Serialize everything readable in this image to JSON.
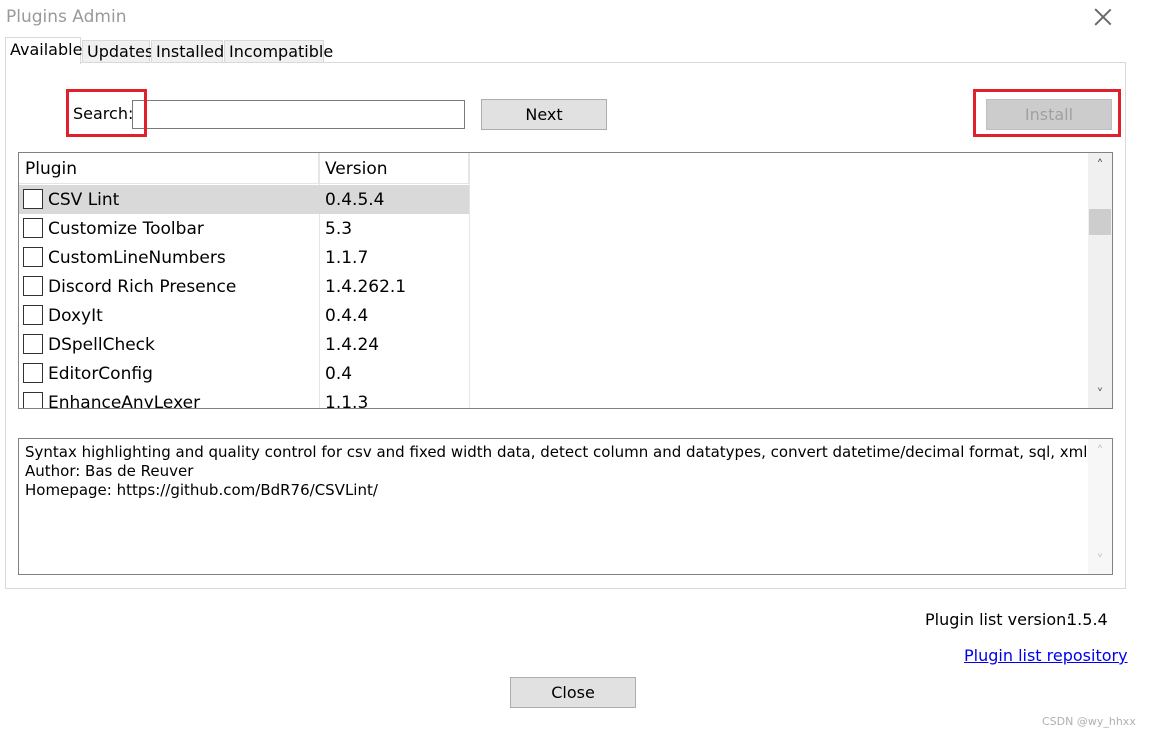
{
  "window": {
    "title": "Plugins Admin"
  },
  "tabs": [
    {
      "label": "Available",
      "active": true
    },
    {
      "label": "Updates",
      "active": false
    },
    {
      "label": "Installed",
      "active": false
    },
    {
      "label": "Incompatible",
      "active": false
    }
  ],
  "search": {
    "label": "Search:",
    "value": "",
    "placeholder": ""
  },
  "buttons": {
    "next": "Next",
    "install": "Install",
    "close": "Close"
  },
  "list": {
    "columns": [
      "Plugin",
      "Version"
    ],
    "rows": [
      {
        "name": "CSV Lint",
        "version": "0.4.5.4",
        "checked": false,
        "selected": true
      },
      {
        "name": "Customize Toolbar",
        "version": "5.3",
        "checked": false,
        "selected": false
      },
      {
        "name": "CustomLineNumbers",
        "version": "1.1.7",
        "checked": false,
        "selected": false
      },
      {
        "name": "Discord Rich Presence",
        "version": "1.4.262.1",
        "checked": false,
        "selected": false
      },
      {
        "name": "DoxyIt",
        "version": "0.4.4",
        "checked": false,
        "selected": false
      },
      {
        "name": "DSpellCheck",
        "version": "1.4.24",
        "checked": false,
        "selected": false
      },
      {
        "name": "EditorConfig",
        "version": "0.4",
        "checked": false,
        "selected": false
      },
      {
        "name": "EnhanceAnyLexer",
        "version": "1.1.3",
        "checked": false,
        "selected": false
      }
    ]
  },
  "description": {
    "lines": [
      "Syntax highlighting and quality control for csv and fixed width data, detect column and datatypes, convert datetime/decimal format, sql, xml",
      "Author: Bas de Reuver",
      "Homepage: https://github.com/BdR76/CSVLint/"
    ]
  },
  "footer": {
    "plugin_list_version_label": "Plugin list version:",
    "plugin_list_version": "1.5.4",
    "repo_link": "Plugin list repository"
  },
  "watermark": "CSDN @wy_hhxx",
  "colors": {
    "highlight_box": "#e0202a",
    "link": "#0000ee",
    "selected_row": "#d9d9d9"
  }
}
